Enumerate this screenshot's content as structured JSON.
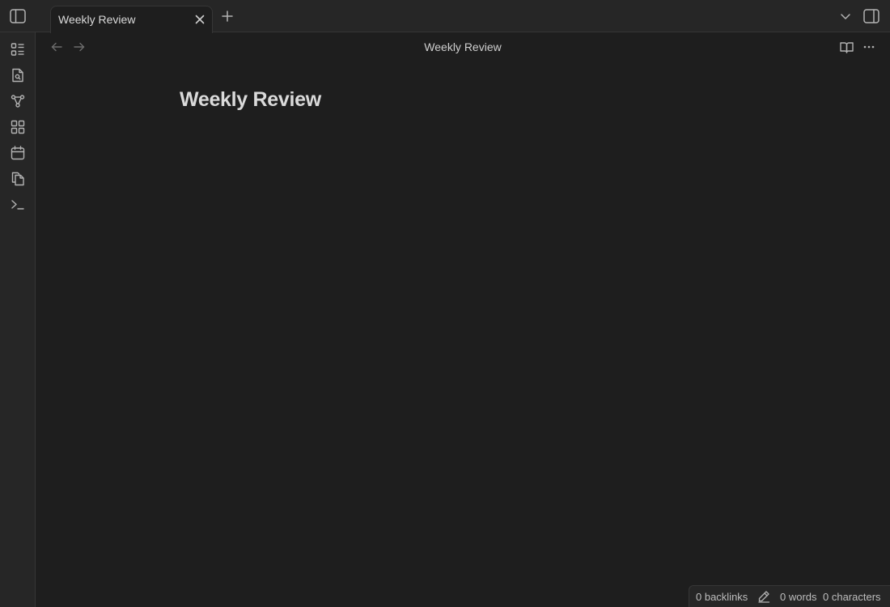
{
  "tab": {
    "label": "Weekly Review"
  },
  "view": {
    "title": "Weekly Review"
  },
  "note": {
    "title": "Weekly Review"
  },
  "statusbar": {
    "backlinks": "0 backlinks",
    "words": "0 words",
    "characters": "0 characters"
  },
  "icons": {
    "titlebar": [
      "sidebar-left-toggle-icon",
      "close-icon",
      "plus-icon",
      "chevron-down-icon",
      "sidebar-right-toggle-icon"
    ],
    "ribbon": [
      "file-tree-icon",
      "search-file-icon",
      "graph-icon",
      "canvas-icon",
      "calendar-icon",
      "copy-icon",
      "terminal-icon"
    ],
    "viewheader": [
      "arrow-left-icon",
      "arrow-right-icon",
      "book-open-icon",
      "more-horizontal-icon"
    ],
    "statusbar": [
      "pencil-icon"
    ]
  },
  "colors": {
    "background": "#1e1e1e",
    "chrome": "#262626",
    "border": "#363636",
    "text": "#dadada"
  }
}
